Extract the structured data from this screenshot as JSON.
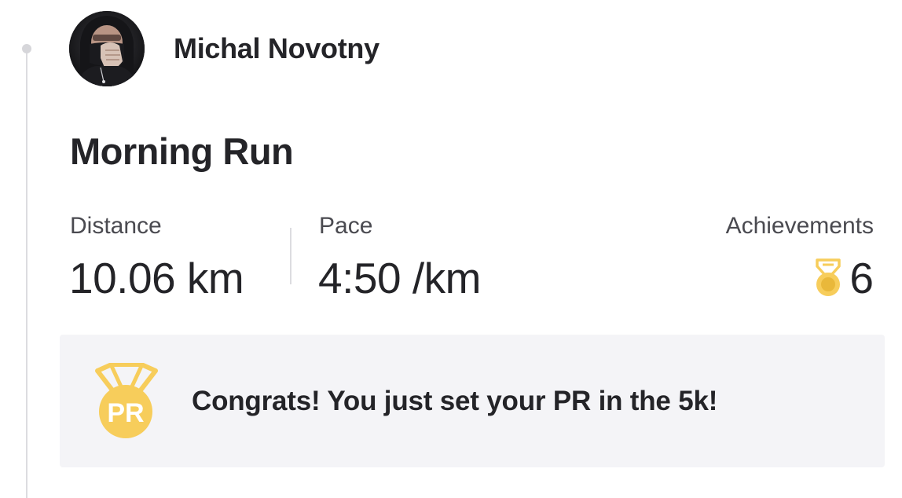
{
  "feed_entry": {
    "athlete": {
      "name": "Michal Novotny",
      "avatar_icon": "avatar-photo"
    },
    "activity": {
      "title": "Morning Run",
      "stats": {
        "distance_label": "Distance",
        "distance_value": "10.06 km",
        "pace_label": "Pace",
        "pace_value": "4:50 /km",
        "achievements_label": "Achievements",
        "achievements_value": "6",
        "achievements_icon": "medal-icon"
      }
    },
    "pr_banner": {
      "message": "Congrats! You just set your PR in the 5k!",
      "badge_text": "PR",
      "badge_icon": "pr-medal-icon"
    }
  },
  "colors": {
    "text_primary": "#242428",
    "text_secondary": "#4a4a50",
    "gold": "#f7cd5b",
    "gold_dark": "#e9b83a",
    "banner_bg": "#f4f4f7",
    "divider": "#dcdce0"
  }
}
